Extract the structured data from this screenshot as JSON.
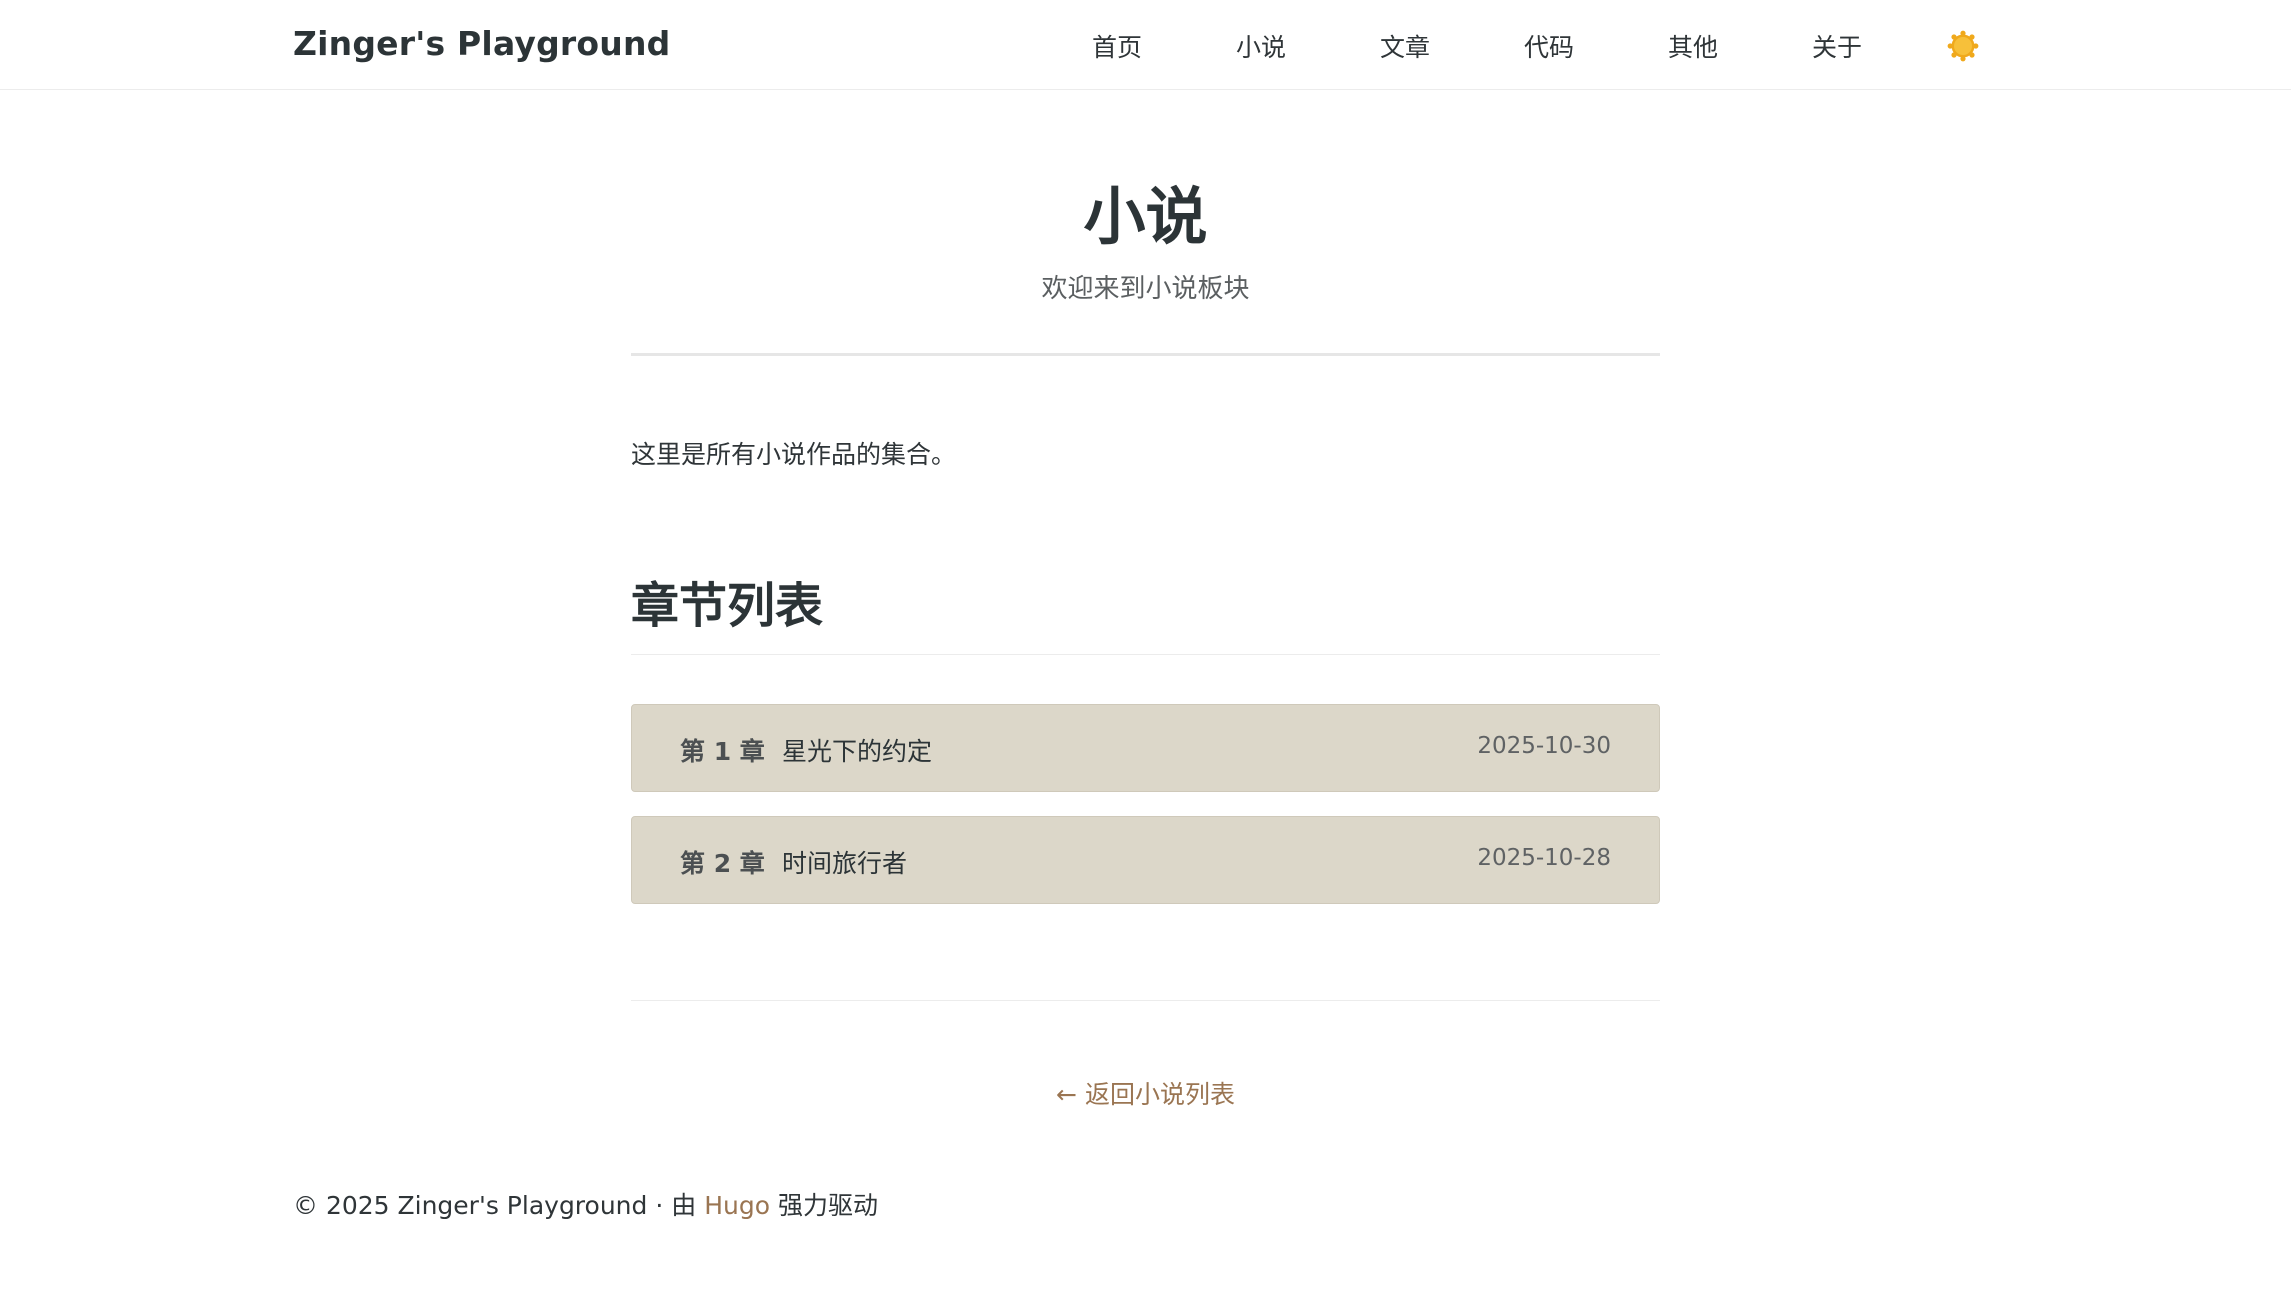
{
  "header": {
    "brand": "Zinger's Playground",
    "nav": [
      {
        "label": "首页"
      },
      {
        "label": "小说"
      },
      {
        "label": "文章"
      },
      {
        "label": "代码"
      },
      {
        "label": "其他"
      },
      {
        "label": "关于"
      }
    ],
    "theme_icon": "sun-icon"
  },
  "page": {
    "title": "小说",
    "subtitle": "欢迎来到小说板块",
    "intro": "这里是所有小说作品的集合。"
  },
  "chapters": {
    "heading": "章节列表",
    "items": [
      {
        "number": "第 1 章",
        "title": "星光下的约定",
        "date": "2025-10-30"
      },
      {
        "number": "第 2 章",
        "title": "时间旅行者",
        "date": "2025-10-28"
      }
    ]
  },
  "back": {
    "arrow": "←",
    "label": "返回小说列表"
  },
  "footer": {
    "prefix": "© 2025 Zinger's Playground · 由 ",
    "link": "Hugo",
    "suffix": " 强力驱动"
  },
  "colors": {
    "accent": "#9a7552",
    "chapter_bg": "#dcd7c9",
    "text": "#2c3437"
  }
}
